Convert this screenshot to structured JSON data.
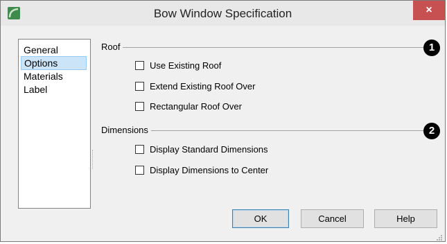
{
  "window": {
    "title": "Bow Window Specification",
    "close_glyph": "×",
    "icon": "app-logo-icon"
  },
  "nav": {
    "items": [
      {
        "label": "General",
        "selected": false
      },
      {
        "label": "Options",
        "selected": true
      },
      {
        "label": "Materials",
        "selected": false
      },
      {
        "label": "Label",
        "selected": false
      }
    ]
  },
  "roof": {
    "label": "Roof",
    "badge": "1",
    "options": [
      {
        "label": "Use Existing Roof",
        "checked": false
      },
      {
        "label": "Extend Existing Roof Over",
        "checked": false
      },
      {
        "label": "Rectangular Roof Over",
        "checked": false
      }
    ]
  },
  "dimensions": {
    "label": "Dimensions",
    "badge": "2",
    "options": [
      {
        "label": "Display Standard Dimensions",
        "checked": false
      },
      {
        "label": "Display Dimensions to Center",
        "checked": false
      }
    ]
  },
  "buttons": {
    "ok": "OK",
    "cancel": "Cancel",
    "help": "Help"
  },
  "colors": {
    "accent": "#3c7fb1",
    "selection": "#cce4f7",
    "close": "#c75050"
  }
}
